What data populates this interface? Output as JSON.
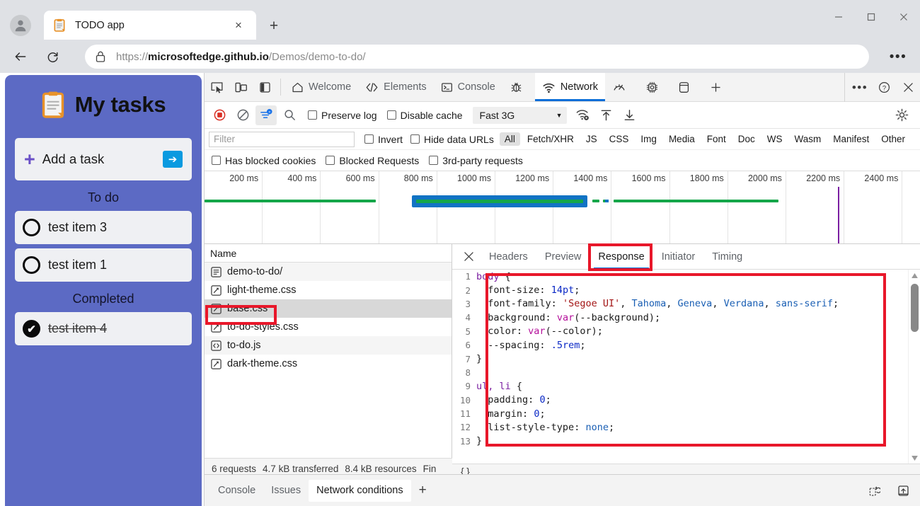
{
  "browser": {
    "tab": {
      "title": "TODO app",
      "favicon": "clipboard-icon",
      "close": "×"
    },
    "newtab": "+",
    "window_controls": {
      "minimize": "—",
      "maximize": "□",
      "close": "✕"
    },
    "nav": {
      "back": "←",
      "reload": "⟳"
    },
    "url": {
      "scheme": "https://",
      "host": "microsoftedge.github.io",
      "path": "/Demos/demo-to-do/",
      "full": "https://microsoftedge.github.io/Demos/demo-to-do/"
    },
    "more_label": "•••"
  },
  "todo": {
    "title": "My tasks",
    "add_task": {
      "label": "Add a task",
      "plus": "+",
      "submit": "➔"
    },
    "sections": [
      {
        "heading": "To do",
        "items": [
          {
            "label": "test item 3",
            "done": false
          },
          {
            "label": "test item 1",
            "done": false
          }
        ]
      },
      {
        "heading": "Completed",
        "items": [
          {
            "label": "test item 4",
            "done": true
          }
        ]
      }
    ],
    "check_glyph": "✔"
  },
  "devtools": {
    "left_icons": [
      "inspect-element-icon",
      "device-toolbar-icon",
      "dock-side-icon"
    ],
    "tabs": [
      {
        "label": "Welcome",
        "icon": "home-icon",
        "active": false
      },
      {
        "label": "Elements",
        "icon": "code-brackets-icon",
        "active": false
      },
      {
        "label": "Console",
        "icon": "terminal-icon",
        "active": false
      },
      {
        "label": "",
        "icon": "bug-icon",
        "active": false
      },
      {
        "label": "Network",
        "icon": "wifi-icon",
        "active": true
      },
      {
        "label": "",
        "icon": "performance-gauge-icon",
        "active": false
      },
      {
        "label": "",
        "icon": "memory-chip-icon",
        "active": false
      },
      {
        "label": "",
        "icon": "application-storage-icon",
        "active": false
      },
      {
        "label": "",
        "icon": "plus-icon",
        "active": false
      }
    ],
    "tabbar_right": {
      "more": "•••",
      "help": "?",
      "close": "✕"
    },
    "toolbar": {
      "record": "record-stop-icon",
      "clear": "clear-icon",
      "filter": "filter-icon",
      "search": "search-icon",
      "preserve_log": "Preserve log",
      "disable_cache": "Disable cache",
      "throttle_value": "Fast 3G",
      "throttle_caret": "▼",
      "network_conditions": "network-conditions-icon",
      "import_har": "import-har-icon",
      "export_har": "export-har-icon",
      "settings": "gear-icon"
    },
    "filterbar": {
      "placeholder": "Filter",
      "invert": "Invert",
      "hide_data_urls": "Hide data URLs",
      "types": [
        "All",
        "Fetch/XHR",
        "JS",
        "CSS",
        "Img",
        "Media",
        "Font",
        "Doc",
        "WS",
        "Wasm",
        "Manifest",
        "Other"
      ],
      "active_type": "All",
      "has_blocked_cookies": "Has blocked cookies",
      "blocked_requests": "Blocked Requests",
      "third_party": "3rd-party requests"
    },
    "overview": {
      "ticks": [
        "200 ms",
        "400 ms",
        "600 ms",
        "800 ms",
        "1000 ms",
        "1200 ms",
        "1400 ms",
        "1600 ms",
        "1800 ms",
        "2000 ms",
        "2200 ms",
        "2400 ms"
      ],
      "marker_color": "#7b1fa2",
      "bar_color": "#15a64a",
      "selection_color": "#1173c4"
    },
    "requests": {
      "column_header": "Name",
      "rows": [
        {
          "name": "demo-to-do/",
          "icon": "document-icon",
          "selected": false
        },
        {
          "name": "light-theme.css",
          "icon": "stylesheet-icon",
          "selected": false
        },
        {
          "name": "base.css",
          "icon": "stylesheet-icon",
          "selected": true
        },
        {
          "name": "to-do-styles.css",
          "icon": "stylesheet-icon",
          "selected": false
        },
        {
          "name": "to-do.js",
          "icon": "script-icon",
          "selected": false
        },
        {
          "name": "dark-theme.css",
          "icon": "stylesheet-icon",
          "selected": false
        }
      ]
    },
    "statusbar": [
      "6 requests",
      "4.7 kB transferred",
      "8.4 kB resources",
      "Fin"
    ],
    "detail": {
      "close": "✕",
      "tabs": [
        "Headers",
        "Preview",
        "Response",
        "Initiator",
        "Timing"
      ],
      "active_tab": "Response",
      "format_button": "{ }",
      "code_lines": [
        {
          "n": 1,
          "text": "body {"
        },
        {
          "n": 2,
          "text": "  font-size: 14pt;"
        },
        {
          "n": 3,
          "text": "  font-family: 'Segoe UI', Tahoma, Geneva, Verdana, sans-serif;"
        },
        {
          "n": 4,
          "text": "  background: var(--background);"
        },
        {
          "n": 5,
          "text": "  color: var(--color);"
        },
        {
          "n": 6,
          "text": "  --spacing: .5rem;"
        },
        {
          "n": 7,
          "text": "}"
        },
        {
          "n": 8,
          "text": ""
        },
        {
          "n": 9,
          "text": "ul, li {"
        },
        {
          "n": 10,
          "text": "  padding: 0;"
        },
        {
          "n": 11,
          "text": "  margin: 0;"
        },
        {
          "n": 12,
          "text": "  list-style-type: none;"
        },
        {
          "n": 13,
          "text": "}"
        }
      ]
    },
    "drawer": {
      "tabs": [
        "Console",
        "Issues",
        "Network conditions"
      ],
      "active_tab": "Network conditions",
      "add": "+",
      "right_icons": [
        "clear-console-icon",
        "dock-drawer-icon"
      ]
    }
  },
  "annotations": {
    "highlight_color": "#e8172a",
    "boxes": [
      "base-css-request-row",
      "response-tab",
      "response-body-code"
    ]
  }
}
